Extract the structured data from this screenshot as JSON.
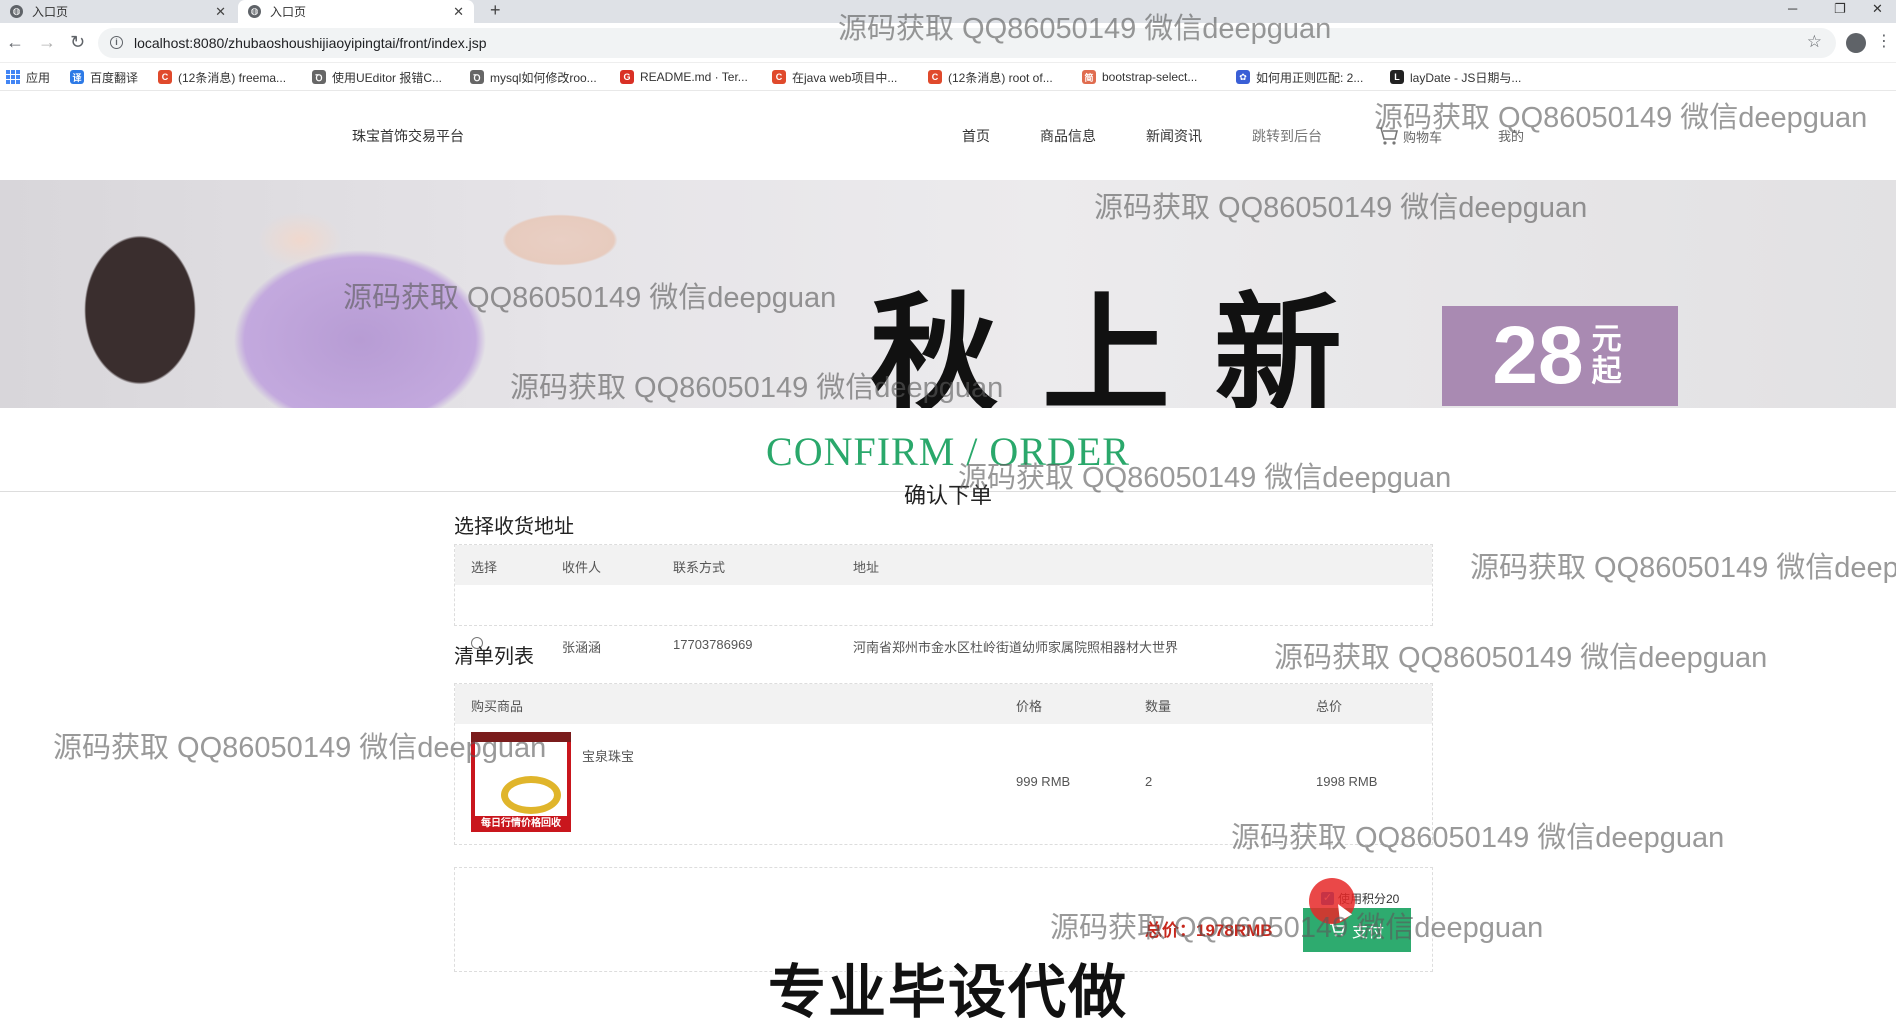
{
  "browser": {
    "tabs": [
      {
        "label": "入口页",
        "close": "✕"
      },
      {
        "label": "入口页",
        "close": "✕"
      }
    ],
    "new_tab": "+",
    "window_controls": {
      "minimize": "─",
      "restore": "❐",
      "close": "✕"
    },
    "url": "localhost:8080/zhubaoshoushijiaoyipingtai/front/index.jsp",
    "bookmarks": [
      {
        "label": "应用",
        "color": "#4285f4"
      },
      {
        "label": "百度翻译",
        "color": "#2d7ae6",
        "icon_char": "译"
      },
      {
        "label": "(12条消息) freema...",
        "color": "#e04a2c",
        "icon_char": "C"
      },
      {
        "label": "使用UEditor 报错C...",
        "color": "#666666",
        "icon_char": "Ꝺ"
      },
      {
        "label": "mysql如何修改roo...",
        "color": "#666666",
        "icon_char": "Ꝺ"
      },
      {
        "label": "README.md · Ter...",
        "color": "#d93025",
        "icon_char": "G"
      },
      {
        "label": "在java web项目中...",
        "color": "#e04a2c",
        "icon_char": "C"
      },
      {
        "label": "(12条消息) root of...",
        "color": "#e04a2c",
        "icon_char": "C"
      },
      {
        "label": "bootstrap-select...",
        "color": "#e06c4f",
        "icon_char": "简"
      },
      {
        "label": "如何用正则匹配: 2...",
        "color": "#3a5fd6",
        "icon_char": "✿"
      },
      {
        "label": "layDate - JS日期与...",
        "color": "#222222",
        "icon_char": "L"
      }
    ]
  },
  "site": {
    "brand": "珠宝首饰交易平台",
    "nav": [
      {
        "label": "首页",
        "muted": false
      },
      {
        "label": "商品信息",
        "muted": false
      },
      {
        "label": "新闻资讯",
        "muted": false
      },
      {
        "label": "跳转到后台",
        "muted": true
      }
    ],
    "cart_label": "购物车",
    "mine_label": "我的"
  },
  "banner": {
    "slogan": "秋上新",
    "price_num": "28",
    "price_unit": "元起"
  },
  "page": {
    "title_en": "CONFIRM / ORDER",
    "title_cn": "确认下单"
  },
  "address_section": {
    "title": "选择收货地址",
    "headers": [
      "选择",
      "收件人",
      "联系方式",
      "地址"
    ],
    "rows": [
      {
        "recipient": "张涵涵",
        "phone": "17703786969",
        "address": "河南省郑州市金水区杜岭街道幼师家属院照相器材大世界"
      }
    ]
  },
  "items_section": {
    "title": "清单列表",
    "headers": [
      "购买商品",
      "价格",
      "数量",
      "总价"
    ],
    "rows": [
      {
        "name": "宝泉珠宝",
        "price": "999 RMB",
        "qty": "2",
        "total": "1998 RMB",
        "thumb_banner": "每日行情价格回收"
      }
    ]
  },
  "payment": {
    "use_points_label": "使用积分20",
    "use_points_checked": true,
    "total_label": "总价：1978RMB",
    "pay_label": "支付",
    "accent": "#2eab6f",
    "total_color": "#c7281d"
  },
  "overlays": {
    "watermark": "源码获取 QQ86050149 微信deepguan",
    "caption": "专业毕设代做"
  }
}
